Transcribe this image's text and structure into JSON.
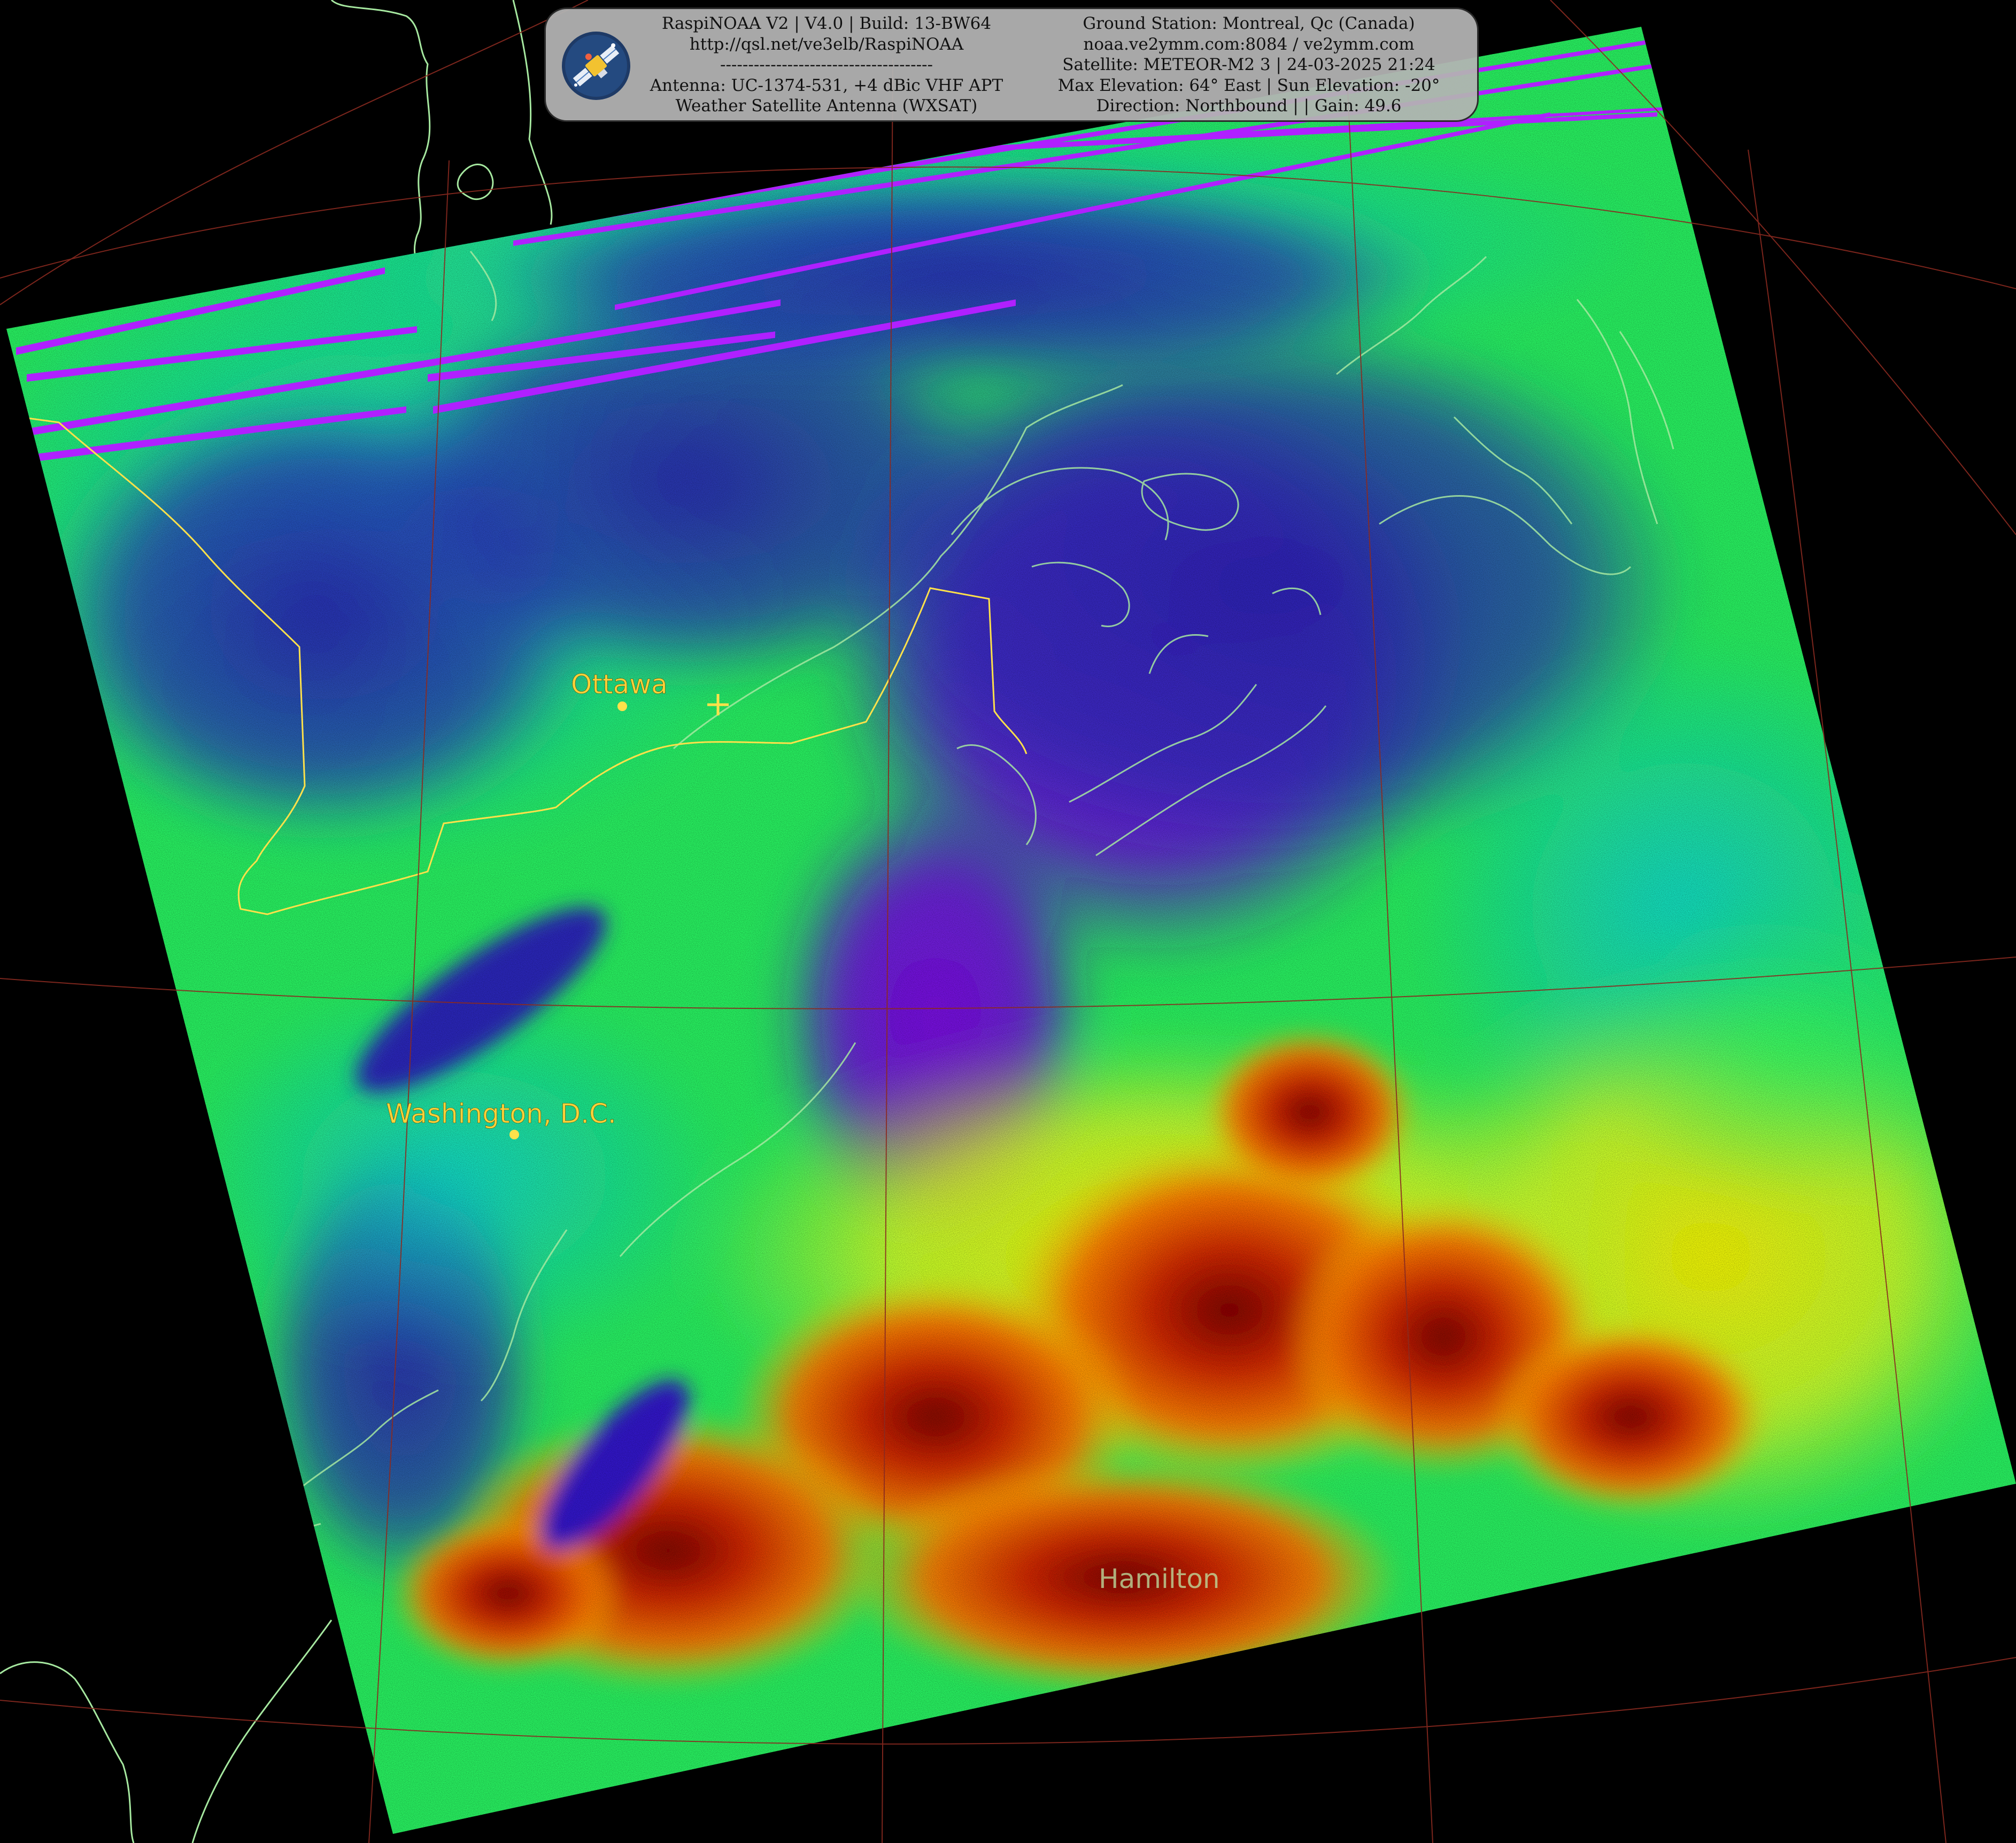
{
  "info_box": {
    "left_lines": [
      "RaspiNOAA V2 | V4.0 | Build: 13-BW64",
      "http://qsl.net/ve3elb/RaspiNOAA",
      "--------------------------------------",
      "Antenna: UC-1374-531, +4 dBic VHF APT",
      "Weather Satellite Antenna (WXSAT)"
    ],
    "right_lines": [
      "Ground Station: Montreal, Qc (Canada)",
      "noaa.ve2ymm.com:8084 / ve2ymm.com",
      "Satellite: METEOR-M2 3 | 24-03-2025 21:24",
      "Max Elevation: 64° East | Sun Elevation: -20°",
      "Direction: Northbound | | Gain: 49.6"
    ],
    "logo_icon": "satellite-icon"
  },
  "map_labels": {
    "ottawa": "Ottawa",
    "washington": "Washington, D.C.",
    "hamilton": "Hamilton"
  },
  "colors": {
    "background": "#000000",
    "coastline": "#a6e8a0",
    "border": "#ffe14a",
    "graticule": "#8a2a20",
    "label": "#ffd23a",
    "scan_glitch": "#b020ff"
  }
}
